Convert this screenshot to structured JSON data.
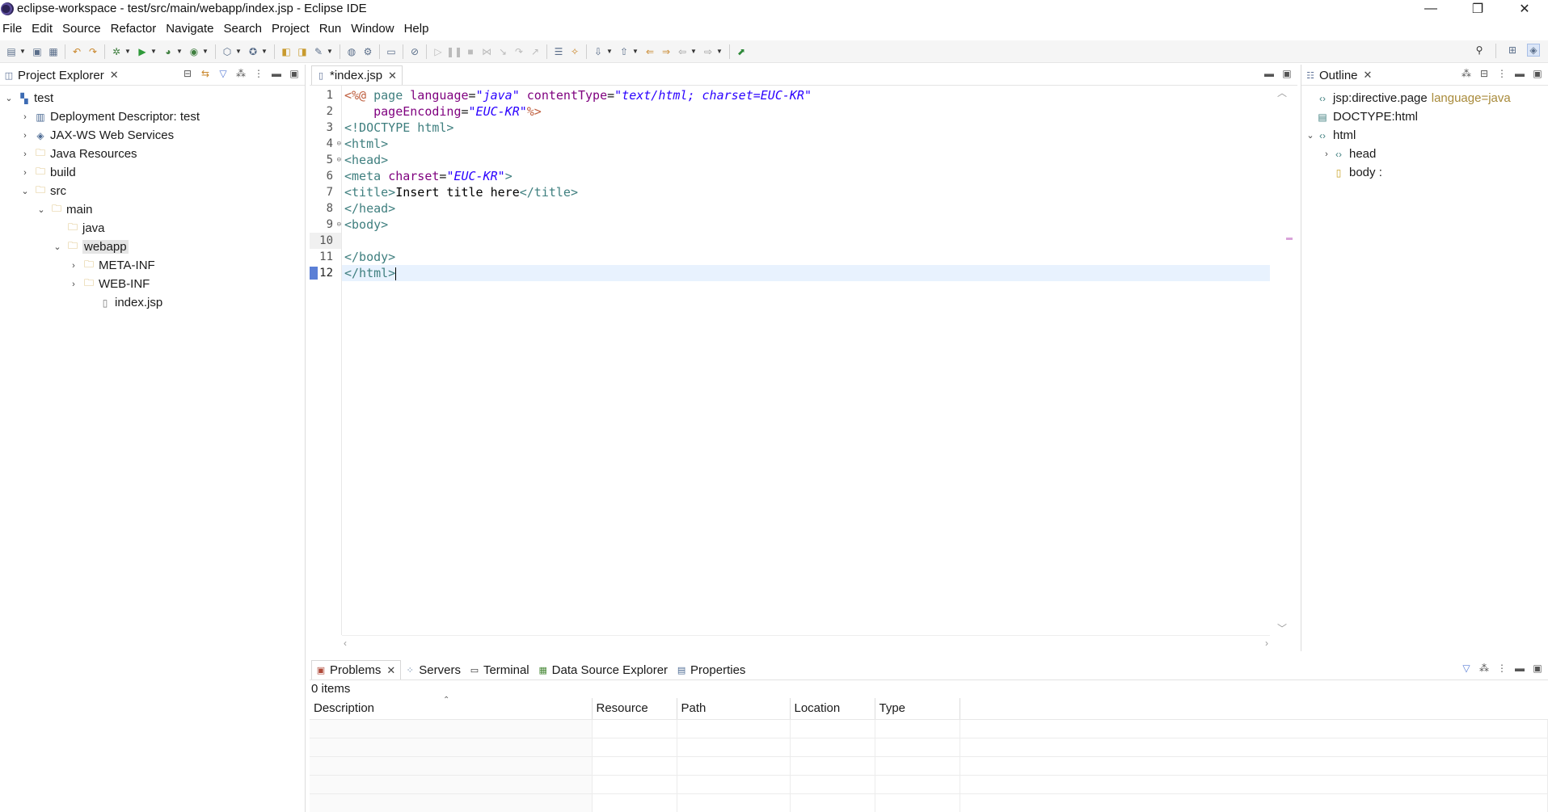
{
  "window": {
    "title": "eclipse-workspace - test/src/main/webapp/index.jsp - Eclipse IDE",
    "controls": [
      "—",
      "❐",
      "✕"
    ]
  },
  "menu": [
    "File",
    "Edit",
    "Source",
    "Refactor",
    "Navigate",
    "Search",
    "Project",
    "Run",
    "Window",
    "Help"
  ],
  "project_explorer": {
    "tab_label": "Project Explorer",
    "tree": [
      {
        "label": "test",
        "depth": 0,
        "expanded": true,
        "icon": "project-icon"
      },
      {
        "label": "Deployment Descriptor: test",
        "depth": 1,
        "expanded": false,
        "icon": "descriptor-icon"
      },
      {
        "label": "JAX-WS Web Services",
        "depth": 1,
        "expanded": false,
        "icon": "webservice-icon"
      },
      {
        "label": "Java Resources",
        "depth": 1,
        "expanded": false,
        "icon": "folder-icon"
      },
      {
        "label": "build",
        "depth": 1,
        "expanded": false,
        "icon": "folder-icon"
      },
      {
        "label": "src",
        "depth": 1,
        "expanded": true,
        "icon": "folder-icon"
      },
      {
        "label": "main",
        "depth": 2,
        "expanded": true,
        "icon": "folder-icon"
      },
      {
        "label": "java",
        "depth": 3,
        "expanded": null,
        "icon": "folder-icon"
      },
      {
        "label": "webapp",
        "depth": 3,
        "expanded": true,
        "icon": "folder-icon",
        "selected": true
      },
      {
        "label": "META-INF",
        "depth": 4,
        "expanded": false,
        "icon": "folder-icon"
      },
      {
        "label": "WEB-INF",
        "depth": 4,
        "expanded": false,
        "icon": "folder-icon"
      },
      {
        "label": "index.jsp",
        "depth": 5,
        "expanded": null,
        "icon": "file-icon"
      }
    ]
  },
  "editor": {
    "tab_label": "*index.jsp",
    "lines": [
      {
        "n": "1",
        "fold": "",
        "html": "<span class=\"jsp\">&lt;%@</span> <span class=\"tag\">page</span> <span class=\"attr\">language</span>=<span class=\"val\">\"java\"</span> <span class=\"attr\">contentType</span>=<span class=\"val\">\"text/html; charset=EUC-KR\"</span>"
      },
      {
        "n": "2",
        "fold": "",
        "html": "    <span class=\"attr\">pageEncoding</span>=<span class=\"val\">\"EUC-KR\"</span><span class=\"jsp\">%&gt;</span>"
      },
      {
        "n": "3",
        "fold": "",
        "html": "<span class=\"tag\">&lt;!DOCTYPE html&gt;</span>"
      },
      {
        "n": "4",
        "fold": "⊖",
        "html": "<span class=\"tag\">&lt;html&gt;</span>"
      },
      {
        "n": "5",
        "fold": "⊖",
        "html": "<span class=\"tag\">&lt;head&gt;</span>"
      },
      {
        "n": "6",
        "fold": "",
        "html": "<span class=\"tag\">&lt;meta</span> <span class=\"attr\">charset</span>=<span class=\"val\">\"EUC-KR\"</span><span class=\"tag\">&gt;</span>"
      },
      {
        "n": "7",
        "fold": "",
        "html": "<span class=\"tag\">&lt;title&gt;</span><span class=\"txt\">Insert title here</span><span class=\"tag\">&lt;/title&gt;</span>"
      },
      {
        "n": "8",
        "fold": "",
        "html": "<span class=\"tag\">&lt;/head&gt;</span>"
      },
      {
        "n": "9",
        "fold": "⊖",
        "html": "<span class=\"tag\">&lt;body&gt;</span>"
      },
      {
        "n": "10",
        "fold": "",
        "html": ""
      },
      {
        "n": "11",
        "fold": "",
        "html": "<span class=\"tag\">&lt;/body&gt;</span>"
      },
      {
        "n": "12",
        "fold": "",
        "html": "<span class=\"tag\">&lt;/html&gt;</span>",
        "current": true
      }
    ]
  },
  "outline": {
    "tab_label": "Outline",
    "items": [
      {
        "label": "jsp:directive.page",
        "extra": "language=java",
        "depth": 0,
        "twisty": "",
        "icon": "directive-icon"
      },
      {
        "label": "DOCTYPE:html",
        "extra": "",
        "depth": 0,
        "twisty": "",
        "icon": "doctype-icon"
      },
      {
        "label": "html",
        "extra": "",
        "depth": 0,
        "twisty": "v",
        "icon": "element-icon"
      },
      {
        "label": "head",
        "extra": "",
        "depth": 1,
        "twisty": ">",
        "icon": "element-icon"
      },
      {
        "label": "body :",
        "extra": "",
        "depth": 1,
        "twisty": "",
        "icon": "body-icon"
      }
    ]
  },
  "bottom": {
    "tabs": [
      {
        "label": "Problems",
        "icon": "problems-icon",
        "active": true
      },
      {
        "label": "Servers",
        "icon": "servers-icon"
      },
      {
        "label": "Terminal",
        "icon": "terminal-icon"
      },
      {
        "label": "Data Source Explorer",
        "icon": "datasource-icon"
      },
      {
        "label": "Properties",
        "icon": "properties-icon"
      }
    ],
    "count": "0 items",
    "columns": [
      "Description",
      "Resource",
      "Path",
      "Location",
      "Type"
    ]
  }
}
